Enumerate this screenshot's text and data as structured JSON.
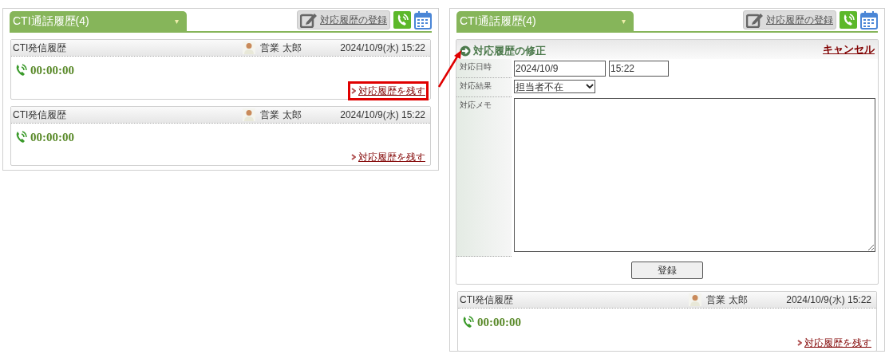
{
  "panels": [
    {
      "tab": {
        "label": "CTI通話履歴(4)",
        "caret": "▾"
      },
      "register_button": "対応履歴の登録",
      "records": [
        {
          "title": "CTI発信履歴",
          "user": "営業 太郎",
          "datetime": "2024/10/9(水) 15:22",
          "duration": "00:00:00",
          "link": "対応履歴を残す",
          "highlighted": true
        },
        {
          "title": "CTI発信履歴",
          "user": "営業 太郎",
          "datetime": "2024/10/9(水) 15:22",
          "duration": "00:00:00",
          "link": "対応履歴を残す",
          "highlighted": false
        }
      ]
    },
    {
      "tab": {
        "label": "CTI通話履歴(4)",
        "caret": "▾"
      },
      "register_button": "対応履歴の登録",
      "edit_form": {
        "title": "対応履歴の修正",
        "cancel": "キャンセル",
        "date_label": "対応日時",
        "date": "2024/10/9",
        "time": "15:22",
        "result_label": "対応結果",
        "result": "担当者不在",
        "memo_label": "対応メモ",
        "submit": "登録"
      },
      "records": [
        {
          "title": "CTI発信履歴",
          "user": "営業 太郎",
          "datetime": "2024/10/9(水) 15:22",
          "duration": "00:00:00",
          "link": "対応履歴を残す",
          "highlighted": false
        }
      ]
    }
  ]
}
